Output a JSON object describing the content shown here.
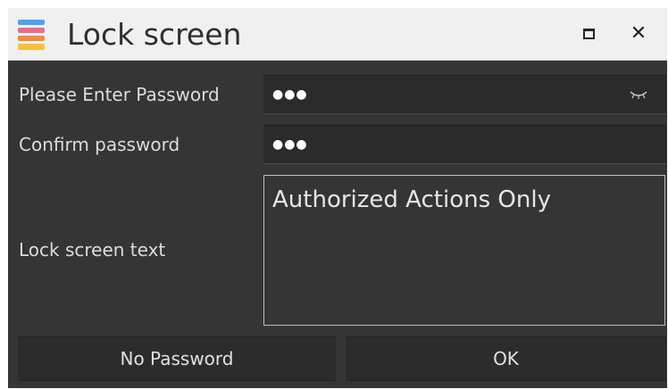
{
  "window": {
    "title": "Lock screen",
    "close_glyph": "✕",
    "icons": [
      "app-logo-icon",
      "maximize-icon",
      "close-icon",
      "password-visibility-icon"
    ]
  },
  "form": {
    "password_label": "Please Enter Password",
    "password_value": "●●●",
    "confirm_label": "Confirm password",
    "confirm_value": "●●●",
    "lock_text_label": "Lock screen text",
    "lock_text_value": "Authorized Actions Only"
  },
  "buttons": {
    "no_password": "No Password",
    "ok": "OK"
  },
  "colors": {
    "background": "#353535",
    "field": "#2b2b2b",
    "titlebar": "#f0f0f0"
  }
}
